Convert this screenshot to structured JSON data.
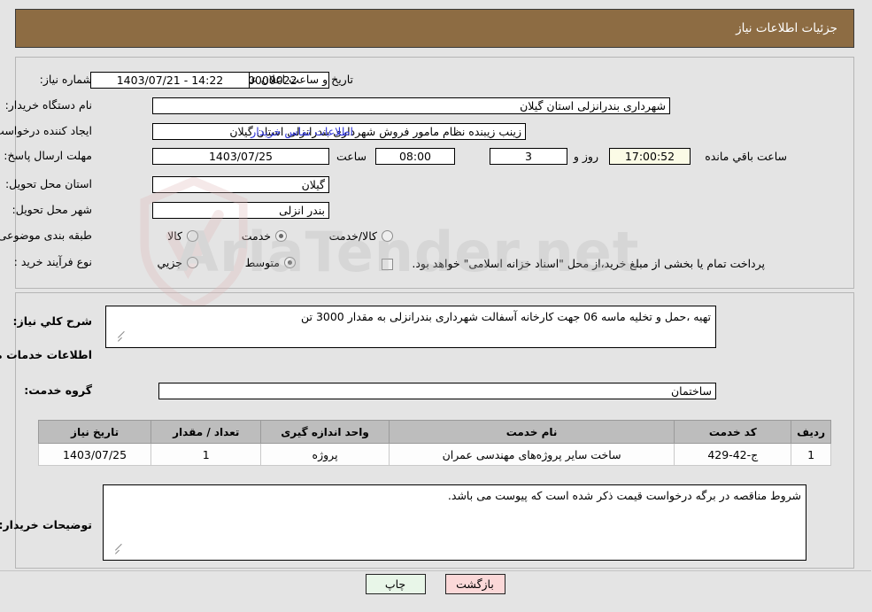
{
  "header": {
    "title": "جزئیات اطلاعات نیاز"
  },
  "top": {
    "need_number_label": "شماره نیاز:",
    "need_number_value": "1103005230000022",
    "announce_label": "تاریخ و ساعت اعلان عمومی:",
    "announce_value": "14:22 - 1403/07/21",
    "buyer_org_label": "نام دستگاه خریدار:",
    "buyer_org_value": "شهرداری بندرانزلی استان گیلان",
    "creator_label": "ایجاد کننده درخواست:",
    "creator_value": "زینب زیبنده نظام مامور فروش شهرداری بندرانزلی استان گیلان",
    "contact_link": "اطلاعات تماس خریدار",
    "deadline_label": "مهلت ارسال پاسخ: تا تاریخ:",
    "deadline_date": "1403/07/25",
    "hour_label": "ساعت",
    "deadline_hour": "08:00",
    "days_value": "3",
    "days_label": "روز و",
    "timer_value": "17:00:52",
    "remaining_label": "ساعت باقي مانده",
    "province_label": "استان محل تحویل:",
    "province_value": "گیلان",
    "city_label": "شهر محل تحویل:",
    "city_value": "بندر انزلی",
    "category_label": "طبقه بندی موضوعی:",
    "category_options": [
      {
        "label": "کالا",
        "selected": false
      },
      {
        "label": "خدمت",
        "selected": true
      },
      {
        "label": "کالا/خدمت",
        "selected": false
      }
    ],
    "process_label": "نوع فرآیند خرید :",
    "process_options": [
      {
        "label": "جزیي",
        "selected": false
      },
      {
        "label": "متوسط",
        "selected": true
      }
    ],
    "treasury_checked": false,
    "treasury_note": "پرداخت تمام یا بخشی از مبلغ خرید،از محل \"اسناد خزانه اسلامی\" خواهد بود."
  },
  "bottom": {
    "general_desc_label": "شرح کلي نیاز:",
    "general_desc_value": "تهیه ،حمل و تخلیه ماسه 06 جهت کارخانه آسفالت شهرداری بندرانزلی به مقدار 3000 تن",
    "services_heading": "اطلاعات خدمات مورد نیاز",
    "service_group_label": "گروه خدمت:",
    "service_group_value": "ساختمان",
    "table": {
      "columns": [
        "ردیف",
        "کد خدمت",
        "نام خدمت",
        "واحد اندازه گیری",
        "تعداد / مقدار",
        "تاریخ نیاز"
      ],
      "rows": [
        [
          "1",
          "ج-42-429",
          "ساخت سایر پروژه‌های مهندسی عمران",
          "پروژه",
          "1",
          "1403/07/25"
        ]
      ]
    },
    "buyer_notes_label": "توضیحات خریدار:",
    "buyer_notes_value": "شروط مناقصه در برگه درخواست قیمت ذکر شده است که پیوست می باشد."
  },
  "footer": {
    "print_label": "چاپ",
    "back_label": "بازگشت"
  },
  "watermark": {
    "text": "AriaTender.net"
  },
  "colors": {
    "header_bg": "#8d6c43",
    "link": "#2f35d6",
    "timer_bg": "#fbfbe6",
    "print_btn": "#e8f6e8",
    "back_btn": "#fbd8d8"
  }
}
